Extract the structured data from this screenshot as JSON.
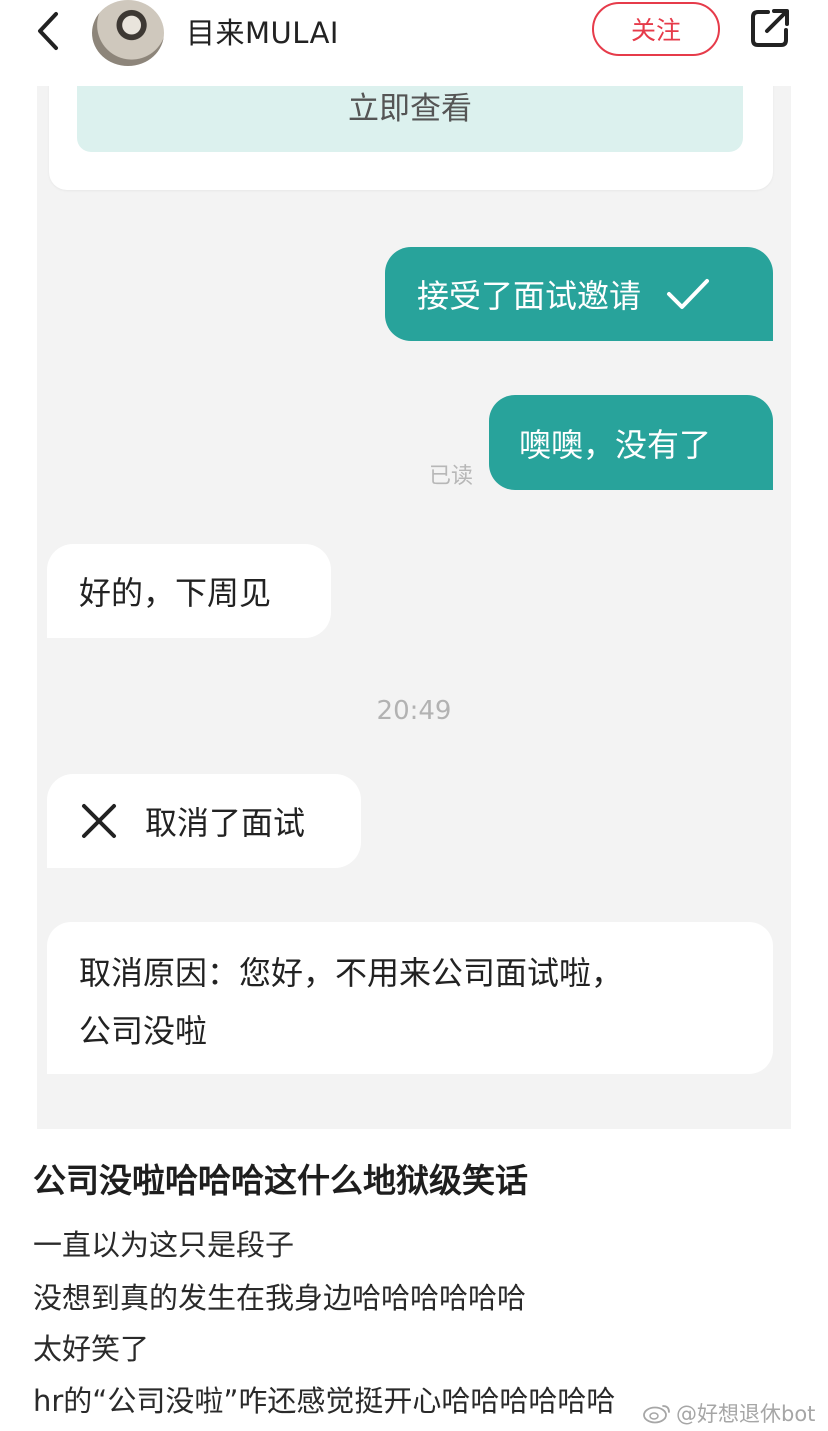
{
  "header": {
    "username": "目来MULAI",
    "follow_label": "关注",
    "icons": {
      "back": "chevron-left-icon",
      "share": "share-icon"
    }
  },
  "chat": {
    "card_button": "立即查看",
    "messages": [
      {
        "side": "right",
        "text": "接受了面试邀请",
        "icon": "check-icon"
      },
      {
        "side": "right",
        "text": "噢噢，没有了",
        "status": "已读"
      },
      {
        "side": "left",
        "text": "好的，下周见"
      },
      {
        "side": "left",
        "text": "取消了面试",
        "icon": "close-icon"
      },
      {
        "side": "left",
        "line1": "取消原因：您好，不用来公司面试啦，",
        "line2": "公司没啦"
      }
    ],
    "timestamp": "20:49",
    "colors": {
      "bubble_right": "#28a39b",
      "card_button_bg": "#dcf1ee",
      "background": "#f3f3f3"
    }
  },
  "post": {
    "title": "公司没啦哈哈哈这什么地狱级笑话",
    "lines": [
      "一直以为这只是段子",
      "没想到真的发生在我身边哈哈哈哈哈哈",
      "太好笑了",
      "hr的“公司没啦”咋还感觉挺开心哈哈哈哈哈哈"
    ]
  },
  "watermark": {
    "text": "@好想退休bot",
    "icon": "weibo-icon"
  },
  "accent_color": "#e63b4a"
}
